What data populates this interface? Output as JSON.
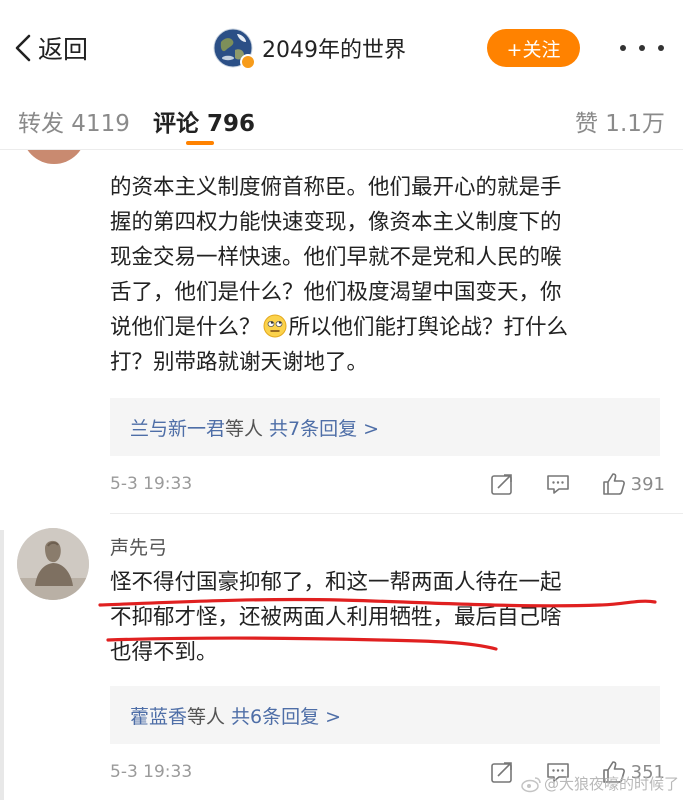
{
  "nav": {
    "back_label": "返回",
    "title": "2049年的世界",
    "follow_label": "+关注"
  },
  "tabs": [
    {
      "label": "转发 4119"
    },
    {
      "label": "评论 796"
    },
    {
      "label": "赞 1.1万"
    }
  ],
  "comment1": {
    "lines": [
      "的资本主义制度俯首称臣。他们最开心的就是手",
      "握的第四权力能快速变现，像资本主义制度下的",
      "现金交易一样快速。他们早就不是党和人民的喉",
      "舌了，他们是什么？他们极度渴望中国变天，你",
      "说他们是什么？",
      "所以他们能打舆论战？打什么",
      "打？别带路就谢天谢地了。"
    ],
    "replies": {
      "names": "兰与新一君",
      "mid": "等人",
      "count": "共7条回复 >"
    },
    "time": "5-3 19:33",
    "likes": "391"
  },
  "comment2": {
    "username": "声先弓",
    "lines": [
      "怪不得付国豪抑郁了，和这一帮两面人待在一起",
      "不抑郁才怪，还被两面人利用牺牲，最后自己啥",
      "也得不到。"
    ],
    "replies": {
      "names": "藿蓝香",
      "mid": "等人",
      "count": "共6条回复 >"
    },
    "time": "5-3 19:33",
    "likes": "351"
  },
  "watermark": "@大狼夜嚎的时候了",
  "colors": {
    "accent": "#ff8200",
    "link": "#4e6ea7",
    "annotation": "#e02020"
  }
}
